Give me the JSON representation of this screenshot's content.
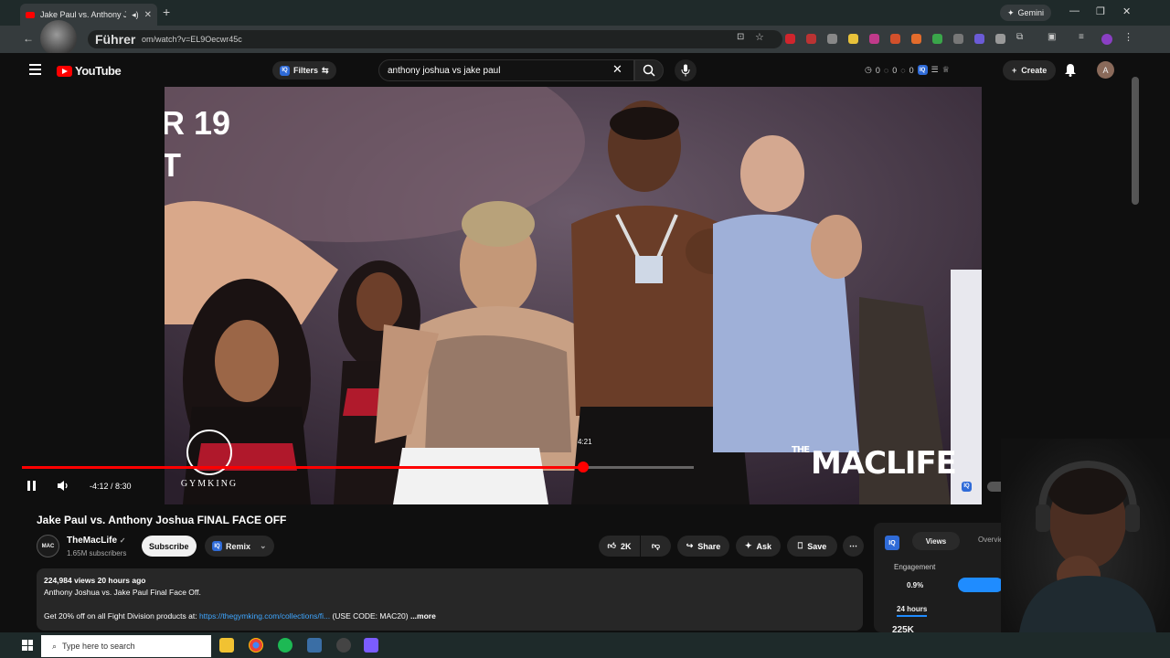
{
  "browser": {
    "tab_title": "Jake Paul vs. Anthony Josh...",
    "gemini_label": "Gemini",
    "url": "om/watch?v=EL9Oecwr45c",
    "overlay_text": "Führer"
  },
  "youtube": {
    "logo_text": "YouTube",
    "filters_label": "Filters",
    "search_value": "anthony joshua vs jake paul",
    "counts": [
      "0",
      "0",
      "0"
    ],
    "create_label": "Create",
    "avatar_letter": "A"
  },
  "video": {
    "title": "Jake Paul vs. Anthony Joshua FINAL FACE OFF",
    "time_display": "-4:12 / 8:30",
    "hover_time": "4:21",
    "progress_fraction": 0.836,
    "watermark_left": "GYMKING",
    "watermark_right": "MACLIFE",
    "watermark_right_prefix": "THE",
    "poster_text": "R 19\nT"
  },
  "channel": {
    "name": "TheMacLife",
    "logo_text": "MAC",
    "subscribers": "1.65M subscribers",
    "subscribe_label": "Subscribe",
    "remix_label": "Remix"
  },
  "actions": {
    "like_count": "2K",
    "share_label": "Share",
    "ask_label": "Ask",
    "save_label": "Save"
  },
  "description": {
    "stats": "224,984 views  20 hours ago",
    "line1": "Anthony Joshua vs. Jake Paul Final Face Off.",
    "line2_prefix": "Get 20% off on all Fight Division products at: ",
    "line2_link": "https://thegymking.com/collections/fi...",
    "line2_suffix": " (USE CODE: MAC20) ",
    "more_label": "...more"
  },
  "side_panel": {
    "tab_views": "Views",
    "tab_overview": "Overview",
    "engagement_label": "Engagement",
    "engagement_value": "0.9%",
    "period_label": "24 hours",
    "views_value": "225K",
    "views_suffix": "Views ove"
  },
  "taskbar": {
    "search_placeholder": "Type here to search"
  }
}
